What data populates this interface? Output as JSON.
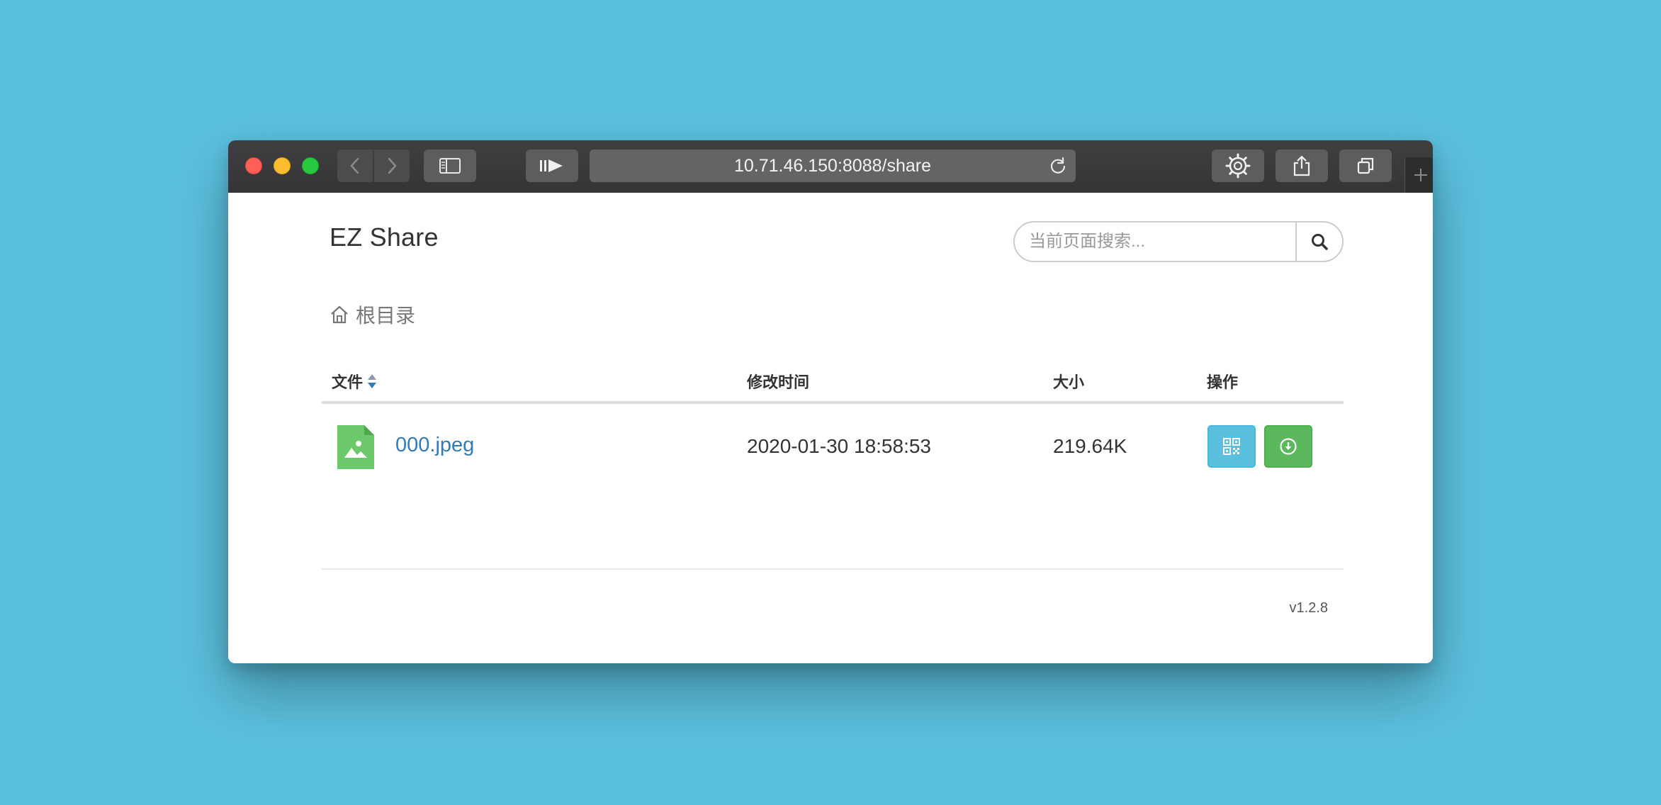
{
  "browser": {
    "url": "10.71.46.150:8088/share"
  },
  "app": {
    "brand": "EZ Share",
    "search_placeholder": "当前页面搜索..."
  },
  "breadcrumb": {
    "label": "根目录"
  },
  "table": {
    "headers": {
      "file": "文件",
      "modified": "修改时间",
      "size": "大小",
      "actions": "操作"
    },
    "rows": [
      {
        "name": "000.jpeg",
        "modified": "2020-01-30 18:58:53",
        "size": "219.64K",
        "icon": "image-file-icon"
      }
    ]
  },
  "footer": {
    "version": "v1.2.8"
  },
  "colors": {
    "desktop": "#5bc0de",
    "link": "#337ab7",
    "qr_button": "#5bc0de",
    "download_button": "#5cb85c",
    "file_icon": "#6cc96b"
  }
}
